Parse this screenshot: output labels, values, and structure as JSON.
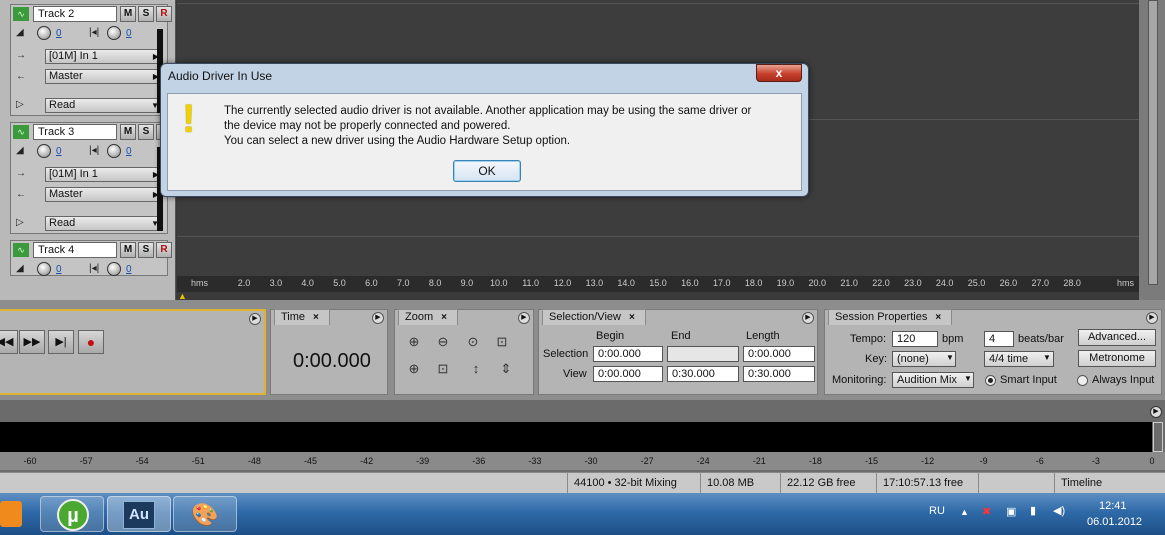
{
  "tracks": [
    {
      "name": "Track 2",
      "vol": "0",
      "pan": "0",
      "input": "[01M] In 1",
      "output": "Master",
      "automation": "Read"
    },
    {
      "name": "Track 3",
      "vol": "0",
      "pan": "0",
      "input": "[01M] In 1",
      "output": "Master",
      "automation": "Read"
    },
    {
      "name": "Track 4",
      "vol": "0",
      "pan": "0"
    }
  ],
  "track_buttons": {
    "mute": "M",
    "solo": "S",
    "record": "R"
  },
  "ruler": {
    "unit_left": "hms",
    "unit_right": "hms",
    "ticks": [
      "2.0",
      "3.0",
      "4.0",
      "5.0",
      "6.0",
      "7.0",
      "8.0",
      "9.0",
      "10.0",
      "11.0",
      "12.0",
      "13.0",
      "14.0",
      "15.0",
      "16.0",
      "17.0",
      "18.0",
      "19.0",
      "20.0",
      "21.0",
      "22.0",
      "23.0",
      "24.0",
      "25.0",
      "26.0",
      "27.0",
      "28.0"
    ]
  },
  "time_panel": {
    "tab": "Time",
    "value": "0:00.000"
  },
  "zoom_panel": {
    "tab": "Zoom"
  },
  "selection_panel": {
    "tab": "Selection/View",
    "headers": {
      "begin": "Begin",
      "end": "End",
      "length": "Length"
    },
    "selection_label": "Selection",
    "view_label": "View",
    "selection": {
      "begin": "0:00.000",
      "end": "",
      "length": "0:00.000"
    },
    "view": {
      "begin": "0:00.000",
      "end": "0:30.000",
      "length": "0:30.000"
    }
  },
  "session_panel": {
    "tab": "Session Properties",
    "tempo_label": "Tempo:",
    "tempo": "120",
    "tempo_unit": "bpm",
    "beats": "4",
    "beats_unit": "beats/bar",
    "key_label": "Key:",
    "key": "(none)",
    "time_sig": "4/4 time",
    "monitoring_label": "Monitoring:",
    "monitoring": "Audition Mix",
    "smart_input": "Smart Input",
    "always_input": "Always Input",
    "advanced": "Advanced...",
    "metronome": "Metronome"
  },
  "meter_scale": [
    "-60",
    "-57",
    "-54",
    "-51",
    "-48",
    "-45",
    "-42",
    "-39",
    "-36",
    "-33",
    "-30",
    "-27",
    "-24",
    "-21",
    "-18",
    "-15",
    "-12",
    "-9",
    "-6",
    "-3",
    "0"
  ],
  "status": {
    "format": "44100 • 32-bit Mixing",
    "size": "10.08 MB",
    "disk": "22.12 GB free",
    "time_free": "17:10:57.13 free",
    "view": "Timeline"
  },
  "taskbar": {
    "lang": "RU",
    "time": "12:41",
    "date": "06.01.2012",
    "au_label": "Au"
  },
  "dialog": {
    "title": "Audio Driver In Use",
    "line1": "The currently selected audio driver is not available.  Another application may be using the same driver or",
    "line2": "the device may not be properly connected and powered.",
    "line3": "You can select a new driver using the Audio Hardware Setup option.",
    "ok": "OK",
    "close": "x"
  },
  "colors": {
    "accent_green": "#3c9a3c",
    "warning": "#f0d000",
    "close_red": "#c8402c",
    "taskbar": "#2f6aa8"
  }
}
